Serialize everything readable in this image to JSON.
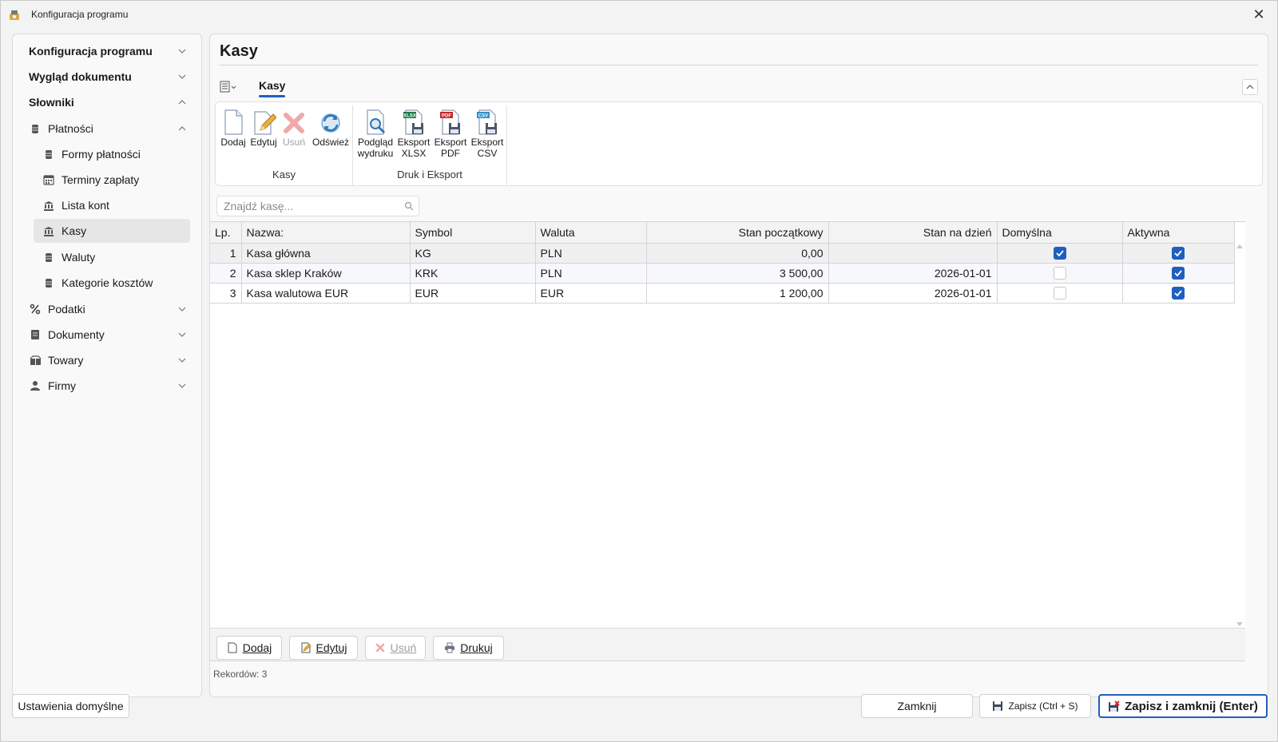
{
  "window": {
    "title": "Konfiguracja programu",
    "close_glyph": "✕"
  },
  "sidebar": {
    "sections": [
      {
        "label": "Konfiguracja programu"
      },
      {
        "label": "Wygląd dokumentu"
      },
      {
        "label": "Słowniki"
      }
    ],
    "items": [
      {
        "label": "Płatności"
      },
      {
        "label": "Formy płatności"
      },
      {
        "label": "Terminy zapłaty"
      },
      {
        "label": "Lista kont"
      },
      {
        "label": "Kasy"
      },
      {
        "label": "Waluty"
      },
      {
        "label": "Kategorie kosztów"
      },
      {
        "label": "Podatki"
      },
      {
        "label": "Dokumenty"
      },
      {
        "label": "Towary"
      },
      {
        "label": "Firmy"
      }
    ]
  },
  "main": {
    "title": "Kasy",
    "ribbon_tab": "Kasy",
    "ribbon": {
      "buttons": [
        {
          "label": "Dodaj"
        },
        {
          "label": "Edytuj"
        },
        {
          "label": "Usuń"
        },
        {
          "label": "Odśwież"
        },
        {
          "label": "Podgląd\nwydruku"
        },
        {
          "label": "Eksport\nXLSX"
        },
        {
          "label": "Eksport\nPDF"
        },
        {
          "label": "Eksport\nCSV"
        }
      ],
      "groups": [
        {
          "label": "Kasy"
        },
        {
          "label": "Druk i Eksport"
        }
      ],
      "file_tags": [
        "XLSX",
        "PDF",
        "CSV"
      ]
    },
    "search": {
      "placeholder": "Znajdź kasę..."
    },
    "table": {
      "columns": [
        "Lp.",
        "Nazwa:",
        "Symbol",
        "Waluta",
        "Stan początkowy",
        "Stan na dzień",
        "Domyślna",
        "Aktywna"
      ],
      "rows": [
        {
          "lp": "1",
          "nazwa": "Kasa główna",
          "symbol": "KG",
          "waluta": "PLN",
          "stan_poczatkowy": "0,00",
          "stan_na_dzien": "",
          "domyslna": true,
          "aktywna": true
        },
        {
          "lp": "2",
          "nazwa": "Kasa sklep Kraków",
          "symbol": "KRK",
          "waluta": "PLN",
          "stan_poczatkowy": "3 500,00",
          "stan_na_dzien": "2026-01-01",
          "domyslna": false,
          "aktywna": true
        },
        {
          "lp": "3",
          "nazwa": "Kasa walutowa EUR",
          "symbol": "EUR",
          "waluta": "EUR",
          "stan_poczatkowy": "1 200,00",
          "stan_na_dzien": "2026-01-01",
          "domyslna": false,
          "aktywna": true
        }
      ]
    },
    "grid_buttons": {
      "add": "Dodaj",
      "edit": "Edytuj",
      "delete": "Usuń",
      "print": "Drukuj"
    },
    "records": "Rekordów: 3"
  },
  "footer": {
    "defaults": "Ustawienia domyślne",
    "close": "Zamknij",
    "save": "Zapisz (Ctrl + S)",
    "save_close": "Zapisz i zamknij (Enter)"
  },
  "colors": {
    "accent": "#1f5fbf",
    "selected_row": "#f0f0f0"
  }
}
